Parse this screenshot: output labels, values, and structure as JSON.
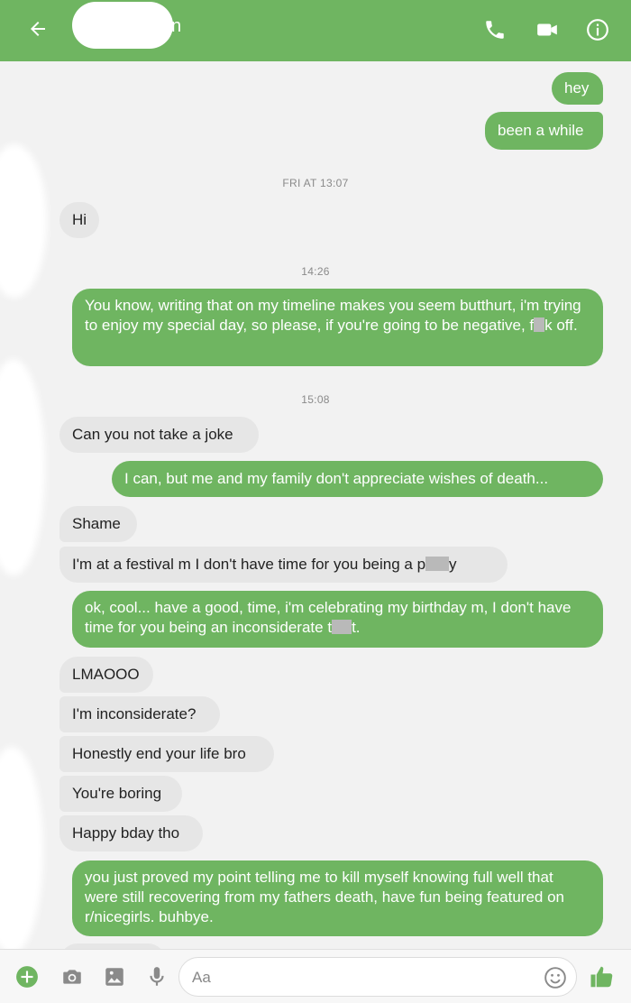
{
  "header": {
    "contact_name_tail": "n",
    "back_icon": "arrow-left-icon",
    "call_icon": "phone-icon",
    "video_icon": "video-camera-icon",
    "info_icon": "info-icon",
    "bar_color": "#6fb561"
  },
  "messages": {
    "m1": "hey",
    "m2": "been a while",
    "t1": "FRI AT 13:07",
    "m3": "Hi",
    "t2": "14:26",
    "m4a": "You know, writing that on my timeline makes you seem butthurt, i'm trying to enjoy my special day, so please, if you're going to be negative, f",
    "m4b": "k off.",
    "t3": "15:08",
    "m5": "Can you not take a joke",
    "m6": "I can, but me and my family don't appreciate wishes of death...",
    "m7": "Shame",
    "m8a": "I'm at a festival m I don't have time for you being a p",
    "m8b": "y",
    "m9a": "ok, cool... have a good, time, i'm celebrating my birthday m, I don't have time for you being an inconsiderate t",
    "m9b": "t.",
    "m10": "LMAOOO",
    "m11": "I'm inconsiderate?",
    "m12": "Honestly end your life bro",
    "m13": "You're boring",
    "m14": "Happy bday tho",
    "m15": "you just proved my point telling me to kill myself knowing full well that were still recovering from my fathers death, have fun being featured on r/nicegirls. buhbye."
  },
  "colors": {
    "outgoing": "#6fb561",
    "incoming": "#e6e6e6"
  },
  "composer": {
    "placeholder": "Aa",
    "add_icon": "plus-circle-icon",
    "camera_icon": "camera-icon",
    "gallery_icon": "image-icon",
    "mic_icon": "microphone-icon",
    "emoji_icon": "emoji-icon",
    "like_icon": "thumbs-up-icon"
  }
}
